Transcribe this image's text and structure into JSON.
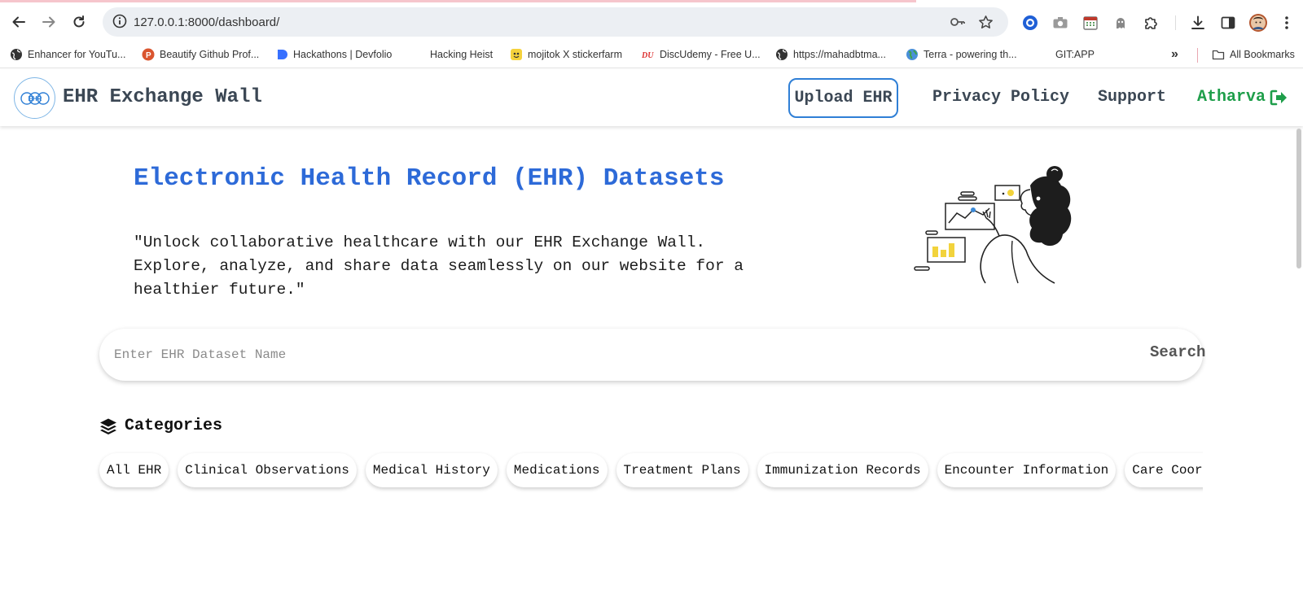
{
  "browser": {
    "url": "127.0.0.1:8000/dashboard/",
    "bookmarks": [
      "Enhancer for YouTu...",
      "Beautify Github Prof...",
      "Hackathons | Devfolio",
      "Hacking Heist",
      "mojitok X stickerfarm",
      "DiscUdemy - Free U...",
      "https://mahadbtma...",
      "Terra - powering th...",
      "GIT:APP"
    ],
    "all_bookmarks": "All Bookmarks"
  },
  "navbar": {
    "logo_text": "EHR",
    "brand": "EHR Exchange Wall",
    "upload": "Upload EHR",
    "privacy": "Privacy Policy",
    "support": "Support",
    "user": "Atharva",
    "user_color": "#1e9e4a",
    "accent_color": "#2d6ad8"
  },
  "hero": {
    "title": "Electronic Health Record (EHR) Datasets",
    "description": "\"Unlock collaborative healthcare with our EHR Exchange Wall. Explore, analyze, and share data seamlessly on our website for a healthier future.\""
  },
  "search": {
    "placeholder": "Enter EHR Dataset Name",
    "value": "",
    "button": "Search"
  },
  "categories": {
    "heading": "Categories",
    "items": [
      "All EHR",
      "Clinical Observations",
      "Medical History",
      "Medications",
      "Treatment Plans",
      "Immunization Records",
      "Encounter Information",
      "Care Coordination"
    ]
  },
  "icons": {
    "back": "arrow-left-icon",
    "forward": "arrow-right-icon",
    "reload": "reload-icon",
    "site_info": "info-icon",
    "password": "key-icon",
    "bookmark_star": "star-icon",
    "logout": "logout-icon",
    "categories": "layers-icon"
  }
}
